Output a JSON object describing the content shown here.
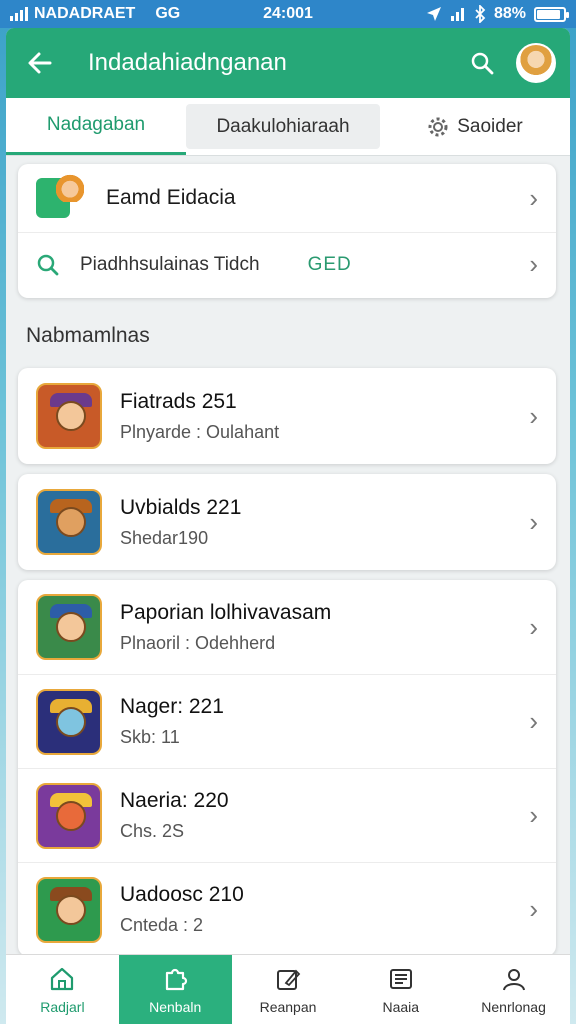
{
  "status_bar": {
    "carrier": "NADADRAET",
    "network": "GG",
    "time": "24:001",
    "battery": "88%",
    "battery_level": 0.88
  },
  "app_bar": {
    "title": "Indadahiadnganan"
  },
  "tabs": [
    {
      "label": "Nadagaban"
    },
    {
      "label": "Daakulohiaraah"
    },
    {
      "label": "Saoider"
    }
  ],
  "top_card": {
    "row1": {
      "title": "Eamd Eidacia"
    },
    "row2": {
      "title": "Piadhhsulainas Tidch",
      "badge": "GED"
    }
  },
  "section": {
    "label": "Nabmamlnas"
  },
  "games": [
    {
      "title": "Fiatrads 251",
      "subtitle": "Plnyarde : Oulahant"
    },
    {
      "title": "Uvbialds 221",
      "subtitle": "Shedar190"
    },
    {
      "title": "Paporian lolhivavasam",
      "subtitle": "Plnaoril : Odehherd"
    },
    {
      "title": "Nager: 221",
      "subtitle": "Skb: 11"
    },
    {
      "title": "Naeria: 220",
      "subtitle": "Chs. 2S"
    },
    {
      "title": "Uadoosc 210",
      "subtitle": "Cnteda : 2"
    }
  ],
  "bottom_nav": [
    {
      "label": "Radjarl",
      "icon": "home-icon"
    },
    {
      "label": "Nenbaln",
      "icon": "puzzle-icon"
    },
    {
      "label": "Reanpan",
      "icon": "edit-icon"
    },
    {
      "label": "Naaia",
      "icon": "news-icon"
    },
    {
      "label": "Nenrlonag",
      "icon": "user-icon"
    }
  ],
  "colors": {
    "primary": "#26a878",
    "status_bar": "#2e86c9"
  }
}
